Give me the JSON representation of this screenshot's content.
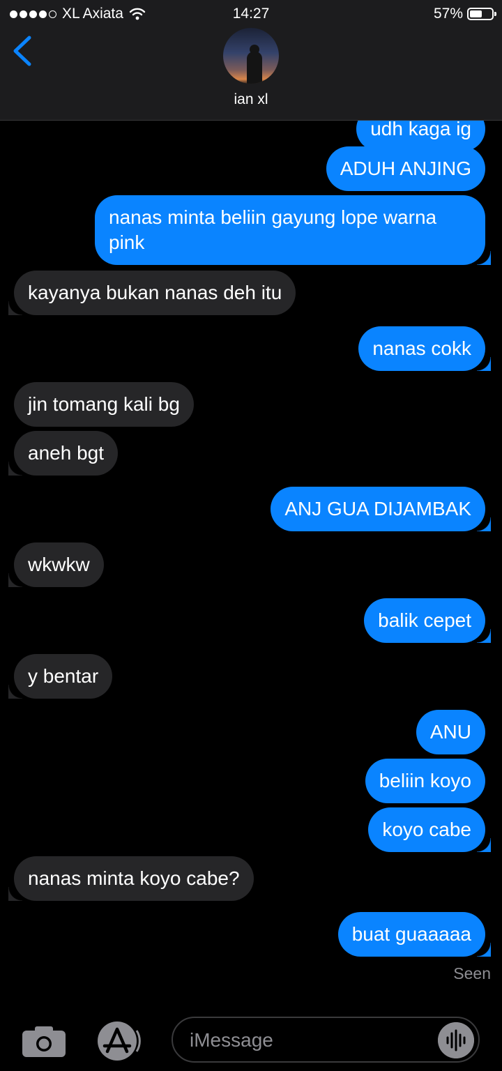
{
  "status_bar": {
    "carrier": "XL Axiata",
    "time": "14:27",
    "battery": "57%",
    "battery_level": 0.57
  },
  "header": {
    "contact_name": "ian xl"
  },
  "messages": [
    {
      "side": "out",
      "text": "udh kaga ig"
    },
    {
      "side": "out",
      "text": "ADUH ANJING"
    },
    {
      "side": "out",
      "text": "nanas minta beliin gayung lope warna pink"
    },
    {
      "side": "in",
      "text": "kayanya bukan nanas deh itu"
    },
    {
      "side": "out",
      "text": "nanas cokk"
    },
    {
      "side": "in",
      "text": "jin tomang kali bg"
    },
    {
      "side": "in",
      "text": "aneh bgt"
    },
    {
      "side": "out",
      "text": "ANJ GUA DIJAMBAK"
    },
    {
      "side": "in",
      "text": "wkwkw"
    },
    {
      "side": "out",
      "text": "balik cepet"
    },
    {
      "side": "in",
      "text": "y bentar"
    },
    {
      "side": "out",
      "text": "ANU"
    },
    {
      "side": "out",
      "text": "beliin koyo"
    },
    {
      "side": "out",
      "text": "koyo cabe"
    },
    {
      "side": "in",
      "text": "nanas minta koyo cabe?"
    },
    {
      "side": "out",
      "text": "buat guaaaaa"
    }
  ],
  "seen_label": "Seen",
  "input": {
    "placeholder": "iMessage"
  },
  "icons": [
    "back-chevron-icon",
    "wifi-icon",
    "battery-icon",
    "camera-icon",
    "app-store-icon",
    "audio-waveform-icon"
  ],
  "colors": {
    "outgoing": "#0a84ff",
    "incoming": "#262628",
    "accent": "#0a84ff"
  }
}
